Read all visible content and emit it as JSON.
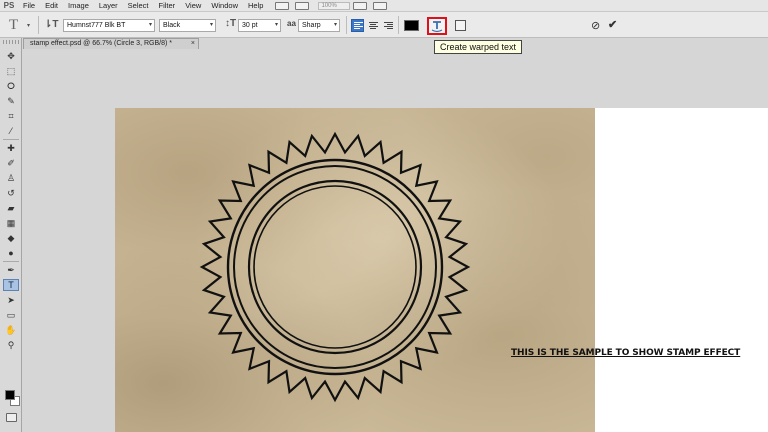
{
  "app": {
    "logo": "PS"
  },
  "menu": [
    "File",
    "Edit",
    "Image",
    "Layer",
    "Select",
    "Filter",
    "View",
    "Window",
    "Help"
  ],
  "zoom_box": "100%",
  "options_bar": {
    "tool_icon": "type-tool-icon",
    "font_family": "Humnst777 Blk BT",
    "font_style": "Black",
    "font_size": "30 pt",
    "antialias_label": "aa",
    "antialias": "Sharp",
    "text_color": "#000000",
    "warp_highlight_color": "#e0101a"
  },
  "tooltip": "Create warped text",
  "document_tab": {
    "title": "stamp effect.psd @ 66.7% (Circle 3, RGB/8) *",
    "close": "×"
  },
  "canvas": {
    "paper_color": "#cdbc9b",
    "sample_text": "THIS IS THE SAMPLE TO SHOW STAMP EFFECT"
  },
  "toolbox": {
    "active_tool": "type-tool",
    "foreground": "#000000",
    "background": "#ffffff"
  }
}
